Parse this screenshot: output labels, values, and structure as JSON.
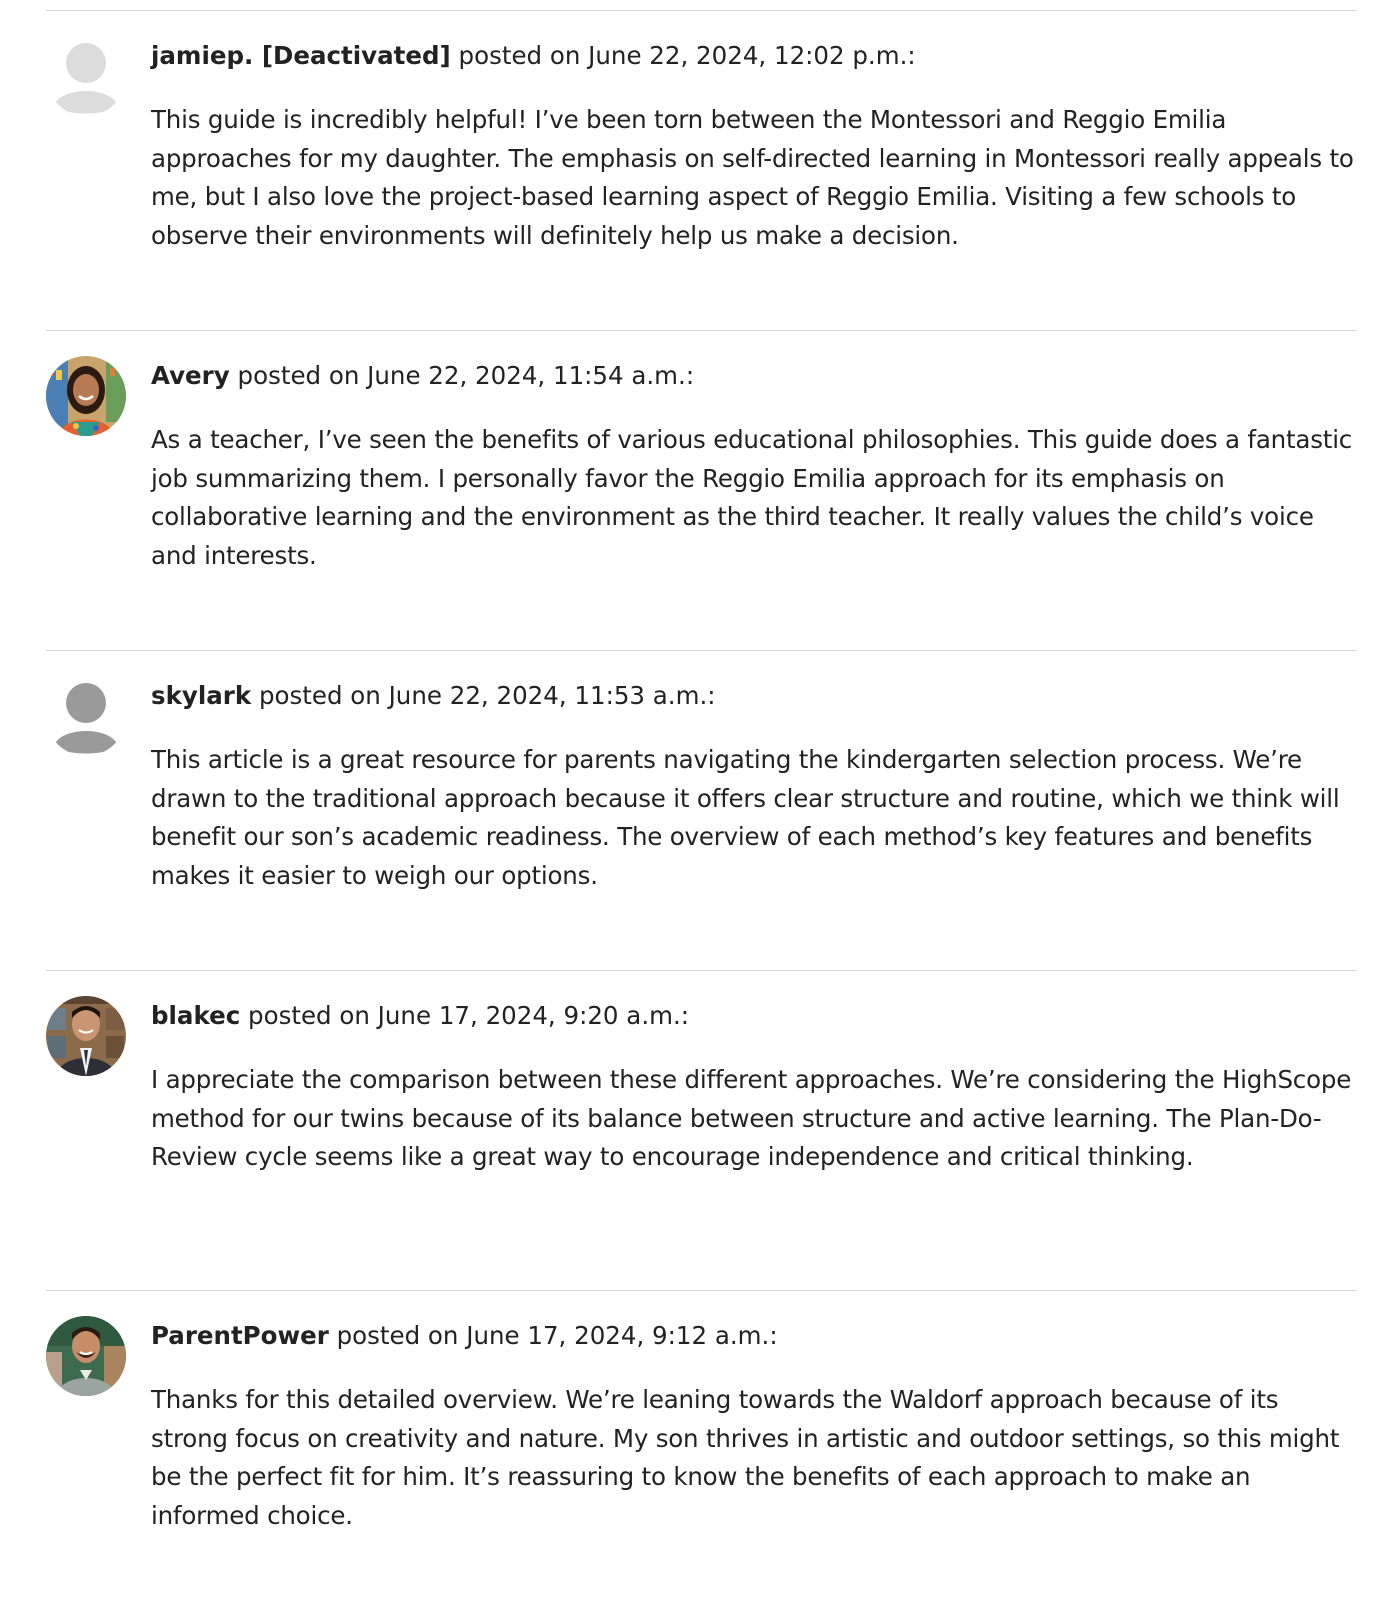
{
  "comments": [
    {
      "author": "jamiep. [Deactivated]",
      "posted_on": "posted on June 22, 2024, 12:02 p.m.:",
      "avatar": "default-avatar-light",
      "text": "This guide is incredibly helpful! I’ve been torn between the Montessori and Reggio Emilia approaches for my daughter. The emphasis on self-directed learning in Montessori really appeals to me, but I also love the project-based learning aspect of Reggio Emilia. Visiting a few schools to observe their environments will definitely help us make a decision."
    },
    {
      "author": "Avery",
      "posted_on": "posted on June 22, 2024, 11:54 a.m.:",
      "avatar": "photo-woman-classroom",
      "text": "As a teacher, I’ve seen the benefits of various educational philosophies. This guide does a fantastic job summarizing them. I personally favor the Reggio Emilia approach for its emphasis on collaborative learning and the environment as the third teacher. It really values the child’s voice and interests."
    },
    {
      "author": "skylark",
      "posted_on": "posted on June 22, 2024, 11:53 a.m.:",
      "avatar": "default-avatar-dark",
      "text": "This article is a great resource for parents navigating the kindergarten selection process. We’re drawn to the traditional approach because it offers clear structure and routine, which we think will benefit our son’s academic readiness. The overview of each method’s key features and benefits makes it easier to weigh our options."
    },
    {
      "author": "blakec",
      "posted_on": "posted on June 17, 2024, 9:20 a.m.:",
      "avatar": "photo-man-suit",
      "text": "I appreciate the comparison between these different approaches. We’re considering the HighScope method for our twins because of its balance between structure and active learning. The Plan-Do-Review cycle seems like a great way to encourage independence and critical thinking."
    },
    {
      "author": "ParentPower",
      "posted_on": "posted on June 17, 2024, 9:12 a.m.:",
      "avatar": "photo-man-classroom",
      "text": "Thanks for this detailed overview. We’re leaning towards the Waldorf approach because of its strong focus on creativity and nature. My son thrives in artistic and outdoor settings, so this might be the perfect fit for him. It’s reassuring to know the benefits of each approach to make an informed choice."
    }
  ]
}
